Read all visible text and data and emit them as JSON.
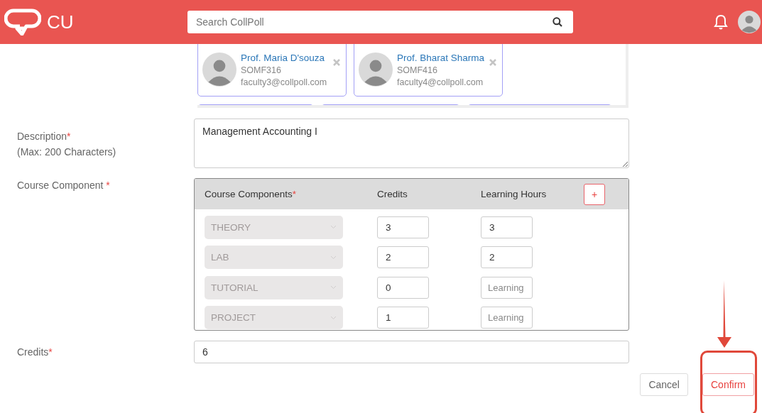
{
  "header": {
    "logo_text": "CU",
    "search": {
      "placeholder": "Search CollPoll"
    }
  },
  "faculty": [
    {
      "kind": "full",
      "name": "Prof. Maria D'souza",
      "code": "SOMF316",
      "email": "faculty3@collpoll.com"
    },
    {
      "kind": "full",
      "name": "Prof. Bharat Sharma",
      "code": "SOMF416",
      "email": "faculty4@collpoll.com"
    },
    {
      "kind": "partial"
    },
    {
      "kind": "partial"
    },
    {
      "kind": "partial"
    }
  ],
  "description": {
    "label": "Description",
    "mark": "*",
    "hint": "(Max: 200 Characters)",
    "value": "Management Accounting I"
  },
  "course_component": {
    "label": "Course Component",
    "mark": "*",
    "columns": [
      {
        "label": "Course Components",
        "mark": "*"
      },
      {
        "label": "Credits"
      },
      {
        "label": "Learning Hours"
      }
    ],
    "add_button": "+",
    "rows": [
      {
        "component": "THEORY",
        "disabled": true,
        "credits": "3",
        "hours": {
          "value": "3"
        }
      },
      {
        "component": "LAB",
        "disabled": true,
        "credits": "2",
        "hours": {
          "value": "2"
        }
      },
      {
        "component": "TUTORIAL",
        "disabled": true,
        "credits": "0",
        "hours": {
          "placeholder": "Learning"
        }
      },
      {
        "component": "PROJECT",
        "disabled": true,
        "credits": "1",
        "hours": {
          "placeholder": "Learning"
        }
      }
    ]
  },
  "credits": {
    "label": "Credits",
    "mark": "*",
    "value": "6"
  },
  "buttons": [
    {
      "label": "Cancel",
      "kind": "secondary",
      "highlighted": false
    },
    {
      "label": "Confirm",
      "kind": "primary",
      "highlighted": true
    }
  ]
}
